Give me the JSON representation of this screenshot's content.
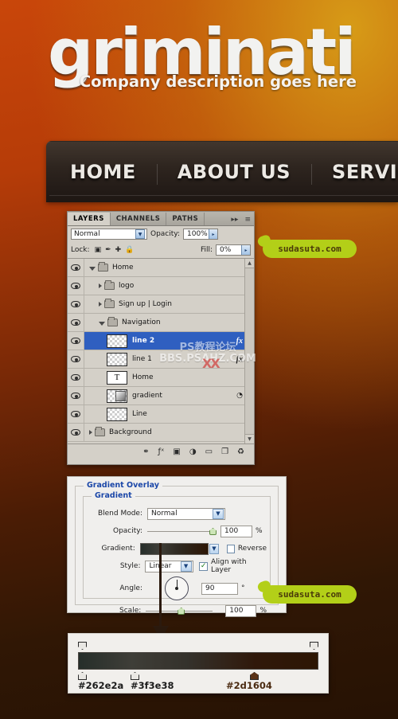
{
  "site": {
    "logo_text": "griminati",
    "tagline": "Company description goes here",
    "nav": [
      {
        "label": "HOME"
      },
      {
        "label": "ABOUT US"
      },
      {
        "label": "SERVICES"
      }
    ]
  },
  "layers_panel": {
    "tabs": [
      {
        "label": "LAYERS",
        "active": true
      },
      {
        "label": "CHANNELS",
        "active": false
      },
      {
        "label": "PATHS",
        "active": false
      }
    ],
    "collapse_icon": "▸▸",
    "menu_icon": "≡",
    "blend_mode": "Normal",
    "opacity_label": "Opacity:",
    "opacity_value": "100%",
    "lock_label": "Lock:",
    "lock_icons": [
      "transparency-lock",
      "brush-lock",
      "move-lock",
      "all-lock"
    ],
    "fill_label": "Fill:",
    "fill_value": "0%",
    "rows": [
      {
        "name": "Home",
        "type": "folder",
        "indent": 0,
        "expanded": true,
        "triangle": "open"
      },
      {
        "name": "logo",
        "type": "folder",
        "indent": 1,
        "expanded": false,
        "triangle": "closed"
      },
      {
        "name": "Sign up  |  Login",
        "type": "folder",
        "indent": 1,
        "expanded": false,
        "triangle": "closed"
      },
      {
        "name": "Navigation",
        "type": "folder",
        "indent": 1,
        "expanded": true,
        "triangle": "open"
      },
      {
        "name": "line 2",
        "type": "pixel",
        "indent": 2,
        "selected": true,
        "fx": "fx"
      },
      {
        "name": "line 1",
        "type": "pixel",
        "indent": 2,
        "selected": false,
        "fx": "fx"
      },
      {
        "name": "Home",
        "type": "text",
        "indent": 2,
        "selected": false,
        "thumb_glyph": "T"
      },
      {
        "name": "gradient",
        "type": "gradient",
        "indent": 2,
        "selected": false,
        "mark": "◔"
      },
      {
        "name": "Line",
        "type": "pixel",
        "indent": 2,
        "selected": false
      },
      {
        "name": "Background",
        "type": "folder",
        "indent": 0,
        "expanded": false,
        "triangle": "closed"
      }
    ],
    "footer_icons": [
      "link-icon",
      "fx-icon",
      "mask-icon",
      "adjustment-icon",
      "group-icon",
      "new-layer-icon",
      "trash-icon"
    ],
    "footer_glyphs": [
      "⚭",
      "ƒˣ",
      "▣",
      "◑",
      "▭",
      "❐",
      "♻"
    ],
    "scroll_up": "▲",
    "scroll_down": "▼"
  },
  "gradient_overlay": {
    "title": "Gradient Overlay",
    "subtitle": "Gradient",
    "blend_mode_label": "Blend Mode:",
    "blend_mode_value": "Normal",
    "opacity_label": "Opacity:",
    "opacity_value": "100",
    "opacity_unit": "%",
    "gradient_label": "Gradient:",
    "reverse_label": "Reverse",
    "reverse_checked": false,
    "style_label": "Style:",
    "style_value": "Linear",
    "align_label": "Align with Layer",
    "align_checked": true,
    "align_check_glyph": "✓",
    "angle_label": "Angle:",
    "angle_value": "90",
    "angle_unit": "°",
    "scale_label": "Scale:",
    "scale_value": "100",
    "scale_unit": "%"
  },
  "gradient_editor": {
    "stops": [
      {
        "hex": "#262e2a",
        "position": 0,
        "color": "#262e2a"
      },
      {
        "hex": "#3f3e38",
        "position": 22,
        "color": "#3f3e38"
      },
      {
        "hex": "#2d1604",
        "position": 70,
        "color": "#2d1604"
      }
    ],
    "opacity_stops": [
      {
        "position": 0
      },
      {
        "position": 100
      }
    ],
    "labels": [
      {
        "text": "#262e2a",
        "left_pct": 0,
        "color": "#1b1b1b"
      },
      {
        "text": "#3f3e38",
        "left_pct": 22,
        "color": "#1b1b1b"
      },
      {
        "text": "#2d1604",
        "left_pct": 57,
        "color": "#4a2a10"
      }
    ]
  },
  "badges": [
    {
      "text": "sudasuta.com"
    },
    {
      "text": "sudasuta.com"
    }
  ],
  "watermark": {
    "line1": "PS教程论坛",
    "line2": "BBS.PSAHZ.COM",
    "mark": "XX"
  },
  "colors": {
    "bg_top": "#c9460a",
    "bg_accent": "#d8a018",
    "bg_bottom": "#261204",
    "nav_bar": "#2e251f",
    "panel_gray": "#d4d0c8",
    "selection_blue": "#2f5fc0",
    "dialog_blue_text": "#1b47a8",
    "badge_green": "#b3cf18",
    "grad_stop_1": "#262e2a",
    "grad_stop_2": "#3f3e38",
    "grad_stop_3": "#2d1604"
  }
}
